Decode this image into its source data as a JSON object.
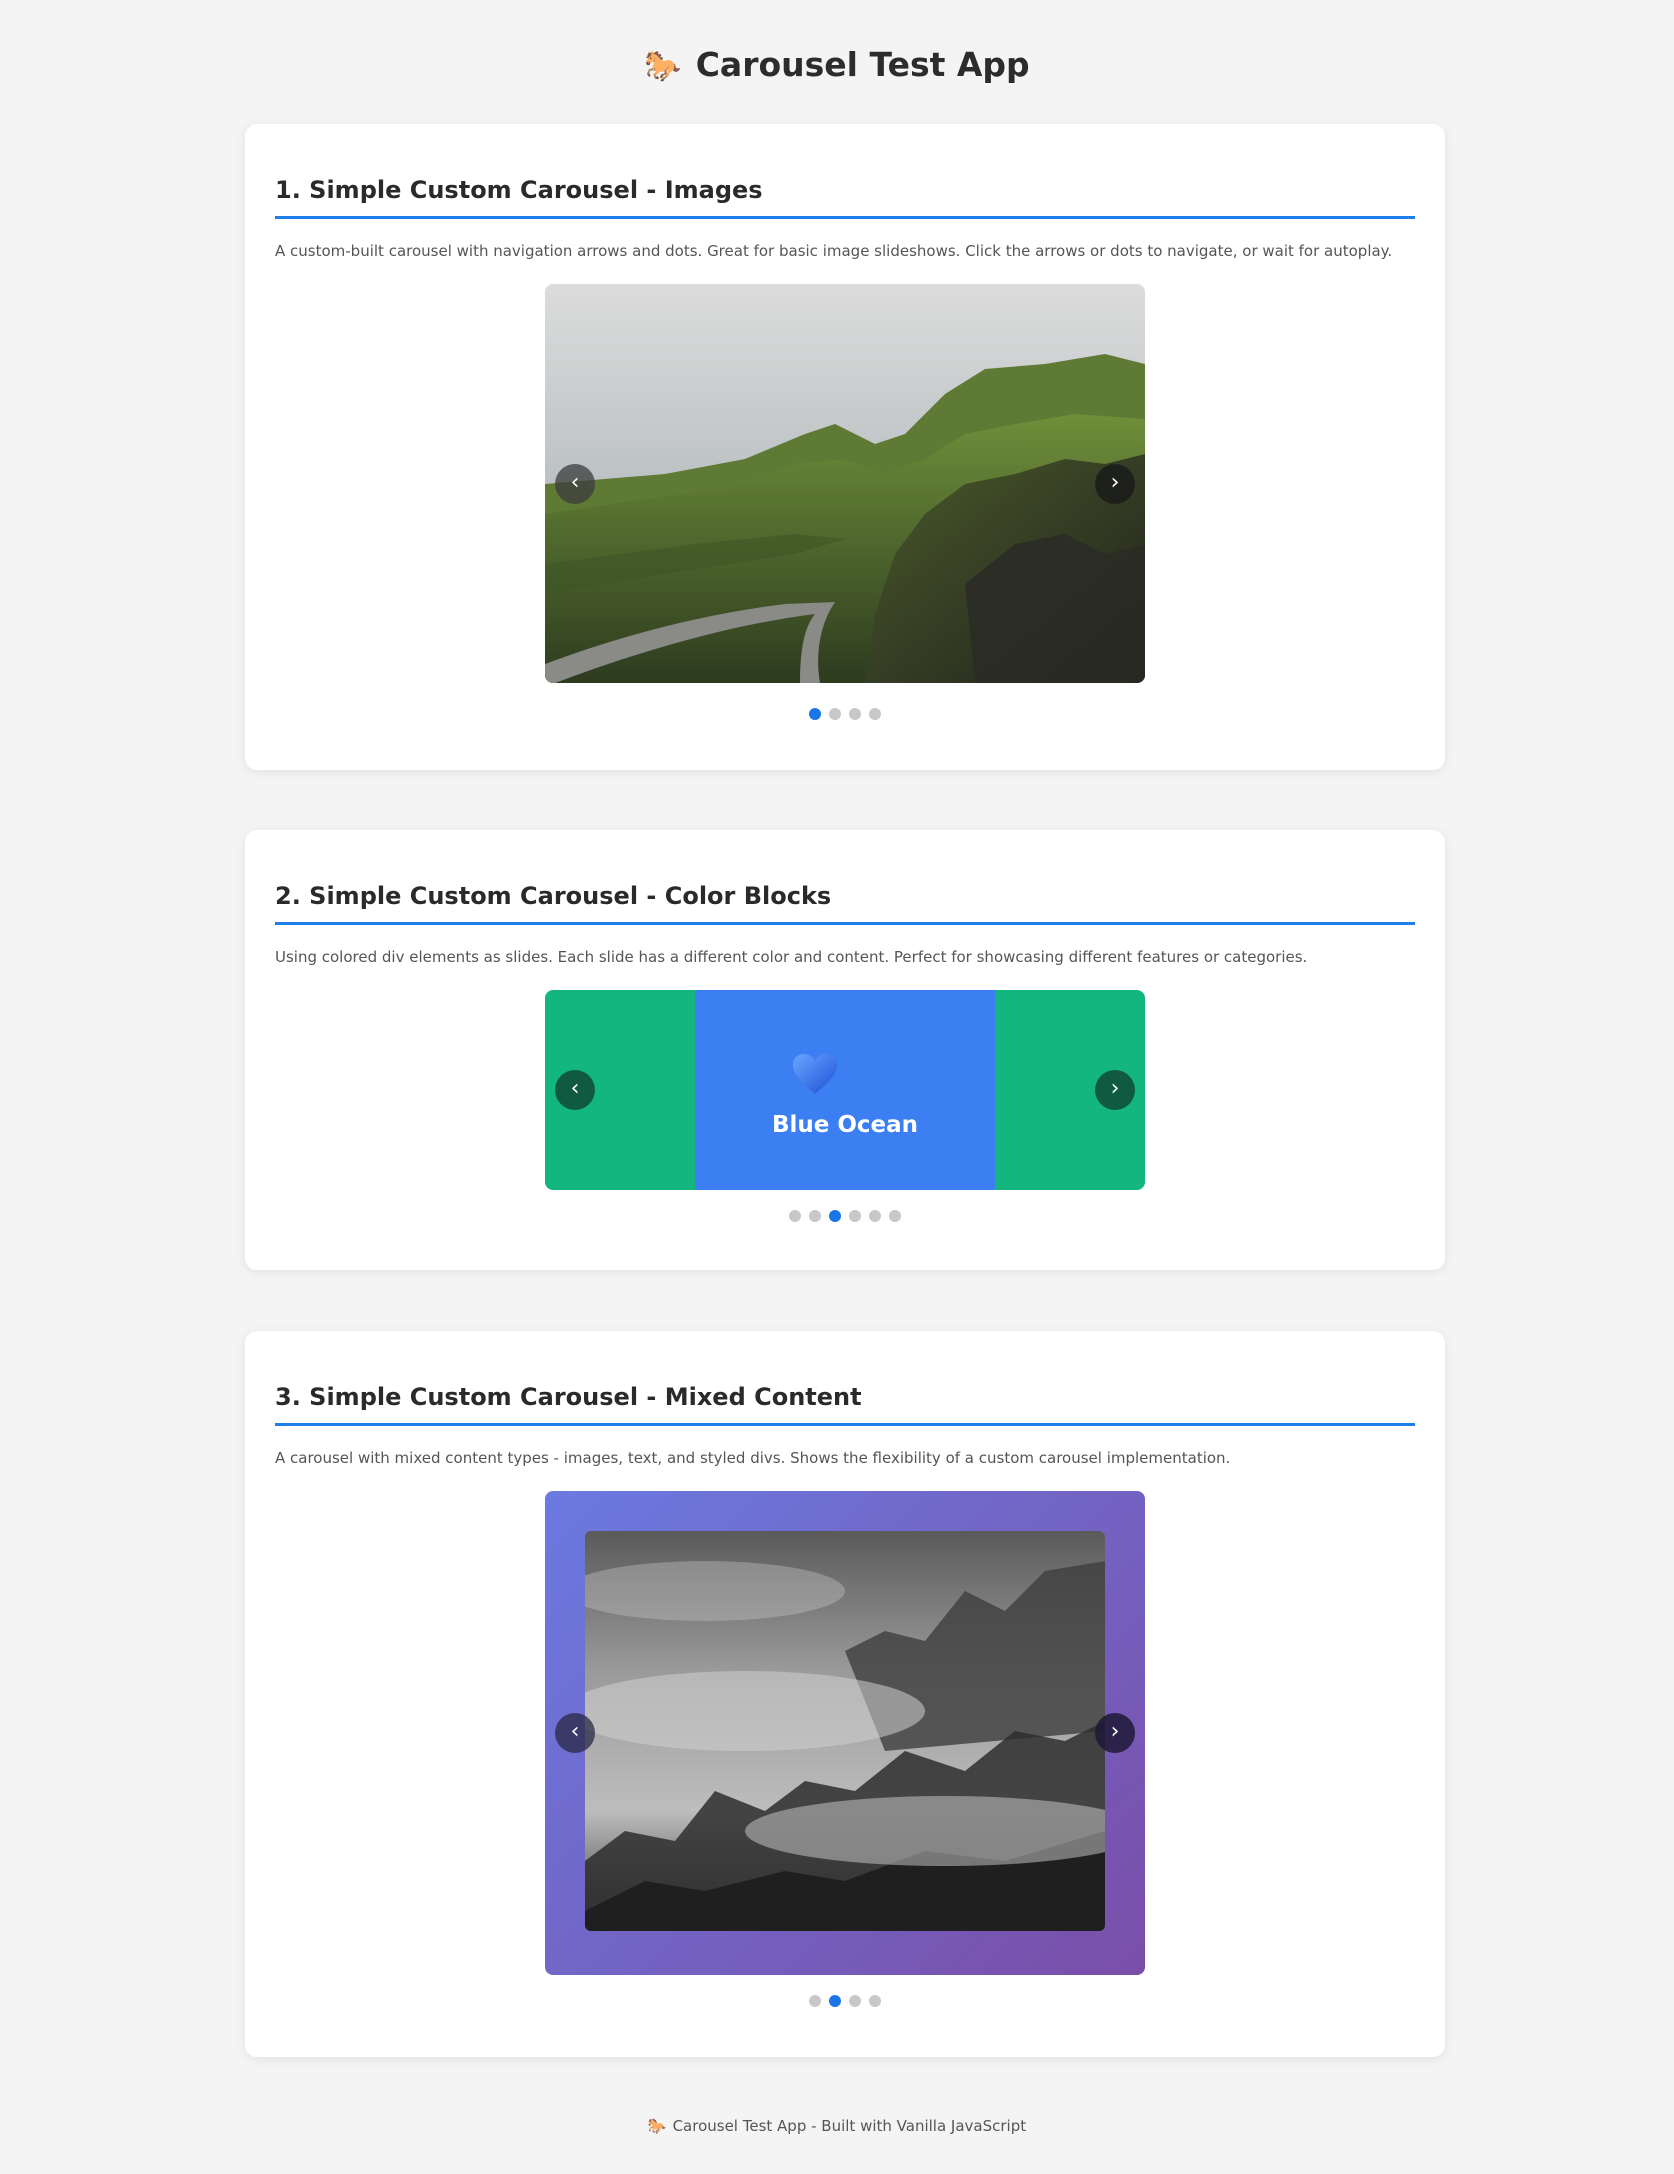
{
  "app": {
    "title": "Carousel Test App",
    "icon": "horse-emoji"
  },
  "sections": [
    {
      "title": "1. Simple Custom Carousel - Images",
      "description": "A custom-built carousel with navigation arrows and dots. Great for basic image slideshows. Click the arrows or dots to navigate, or wait for autoplay.",
      "prev_label": "‹",
      "next_label": "›",
      "slide_count": 4,
      "active_index": 0
    },
    {
      "title": "2. Simple Custom Carousel - Color Blocks",
      "description": "Using colored div elements as slides. Each slide has a different color and content. Perfect for showcasing different features or categories.",
      "prev_label": "‹",
      "next_label": "›",
      "slide_count": 6,
      "active_index": 2,
      "current_slide": {
        "label": "Blue Ocean",
        "icon": "blue-heart-icon",
        "color": "#3b7ff2"
      },
      "side_color": "#13b67f"
    },
    {
      "title": "3. Simple Custom Carousel - Mixed Content",
      "description": "A carousel with mixed content types - images, text, and styled divs. Shows the flexibility of a custom carousel implementation.",
      "prev_label": "‹",
      "next_label": "›",
      "slide_count": 4,
      "active_index": 1,
      "gradient": [
        "#6b7ae0",
        "#7a4ea8"
      ]
    }
  ],
  "footer": {
    "text": "Carousel Test App - Built with Vanilla JavaScript"
  },
  "colors": {
    "accent": "#1a75e8",
    "background": "#f4f4f4",
    "card": "#ffffff"
  }
}
